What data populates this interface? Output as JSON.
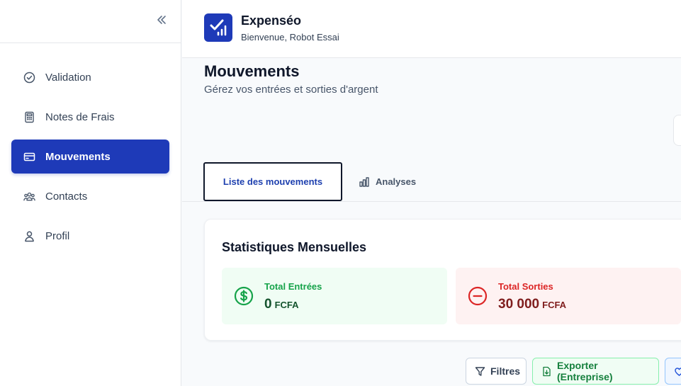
{
  "sidebar": {
    "collapse_icon": "chevrons-left-icon",
    "items": [
      {
        "label": "Validation",
        "icon": "check-circle-icon",
        "active": false
      },
      {
        "label": "Notes de Frais",
        "icon": "calculator-icon",
        "active": false
      },
      {
        "label": "Mouvements",
        "icon": "credit-card-icon",
        "active": true
      },
      {
        "label": "Contacts",
        "icon": "users-icon",
        "active": false
      },
      {
        "label": "Profil",
        "icon": "user-icon",
        "active": false
      }
    ]
  },
  "header": {
    "app_name": "Expenséo",
    "welcome": "Bienvenue, Robot Essai",
    "logo_icon": "check-chart-logo-icon"
  },
  "main": {
    "title": "Mouvements",
    "subtitle": "Gérez vos entrées et sorties d'argent",
    "tabs": [
      {
        "label": "Liste des mouvements",
        "active": true
      },
      {
        "label": "Analyses",
        "icon": "bar-chart-icon",
        "active": false
      }
    ],
    "stats": {
      "title": "Statistiques Mensuelles",
      "income": {
        "label": "Total Entrées",
        "value": "0",
        "unit": "FCFA",
        "icon": "dollar-circle-icon"
      },
      "expense": {
        "label": "Total Sorties",
        "value": "30 000",
        "unit": "FCFA",
        "icon": "minus-circle-icon"
      }
    },
    "actions": {
      "filters": "Filtres",
      "export": "Exporter (Entreprise)"
    }
  },
  "colors": {
    "primary": "#1e3ab8",
    "income": "#16a34a",
    "expense": "#dc2626"
  }
}
